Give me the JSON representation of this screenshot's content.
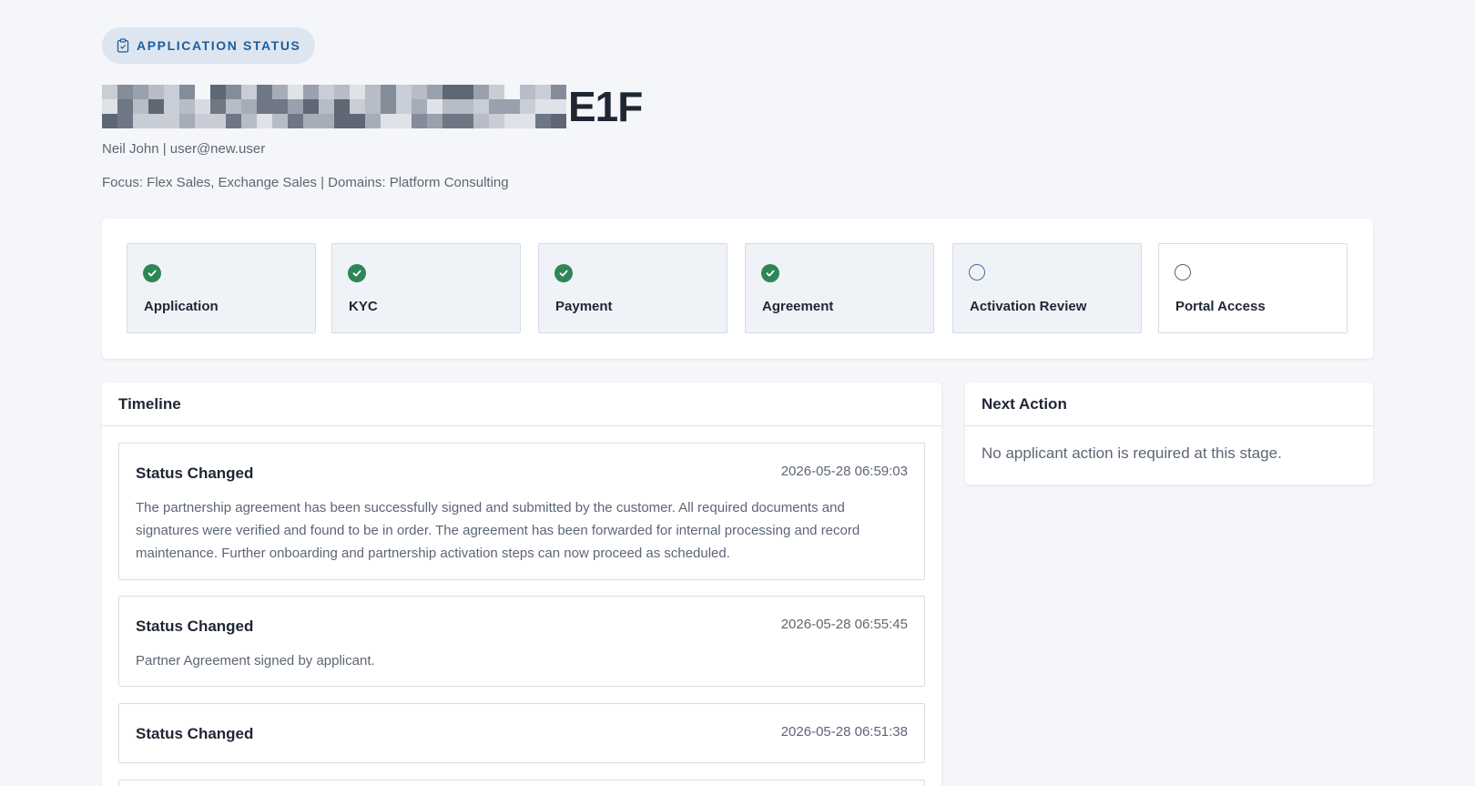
{
  "header": {
    "pill_label": "APPLICATION STATUS",
    "pill_icon": "clipboard-icon",
    "title_visible_suffix": "E1F",
    "user_line": "Neil John | user@new.user",
    "focus_line": "Focus: Flex Sales, Exchange Sales | Domains: Platform Consulting"
  },
  "stages": [
    {
      "label": "Application",
      "status": "complete",
      "icon": "check-circle-icon"
    },
    {
      "label": "KYC",
      "status": "complete",
      "icon": "check-circle-icon"
    },
    {
      "label": "Payment",
      "status": "complete",
      "icon": "check-circle-icon"
    },
    {
      "label": "Agreement",
      "status": "complete",
      "icon": "check-circle-icon"
    },
    {
      "label": "Activation Review",
      "status": "current",
      "icon": "empty-circle-icon"
    },
    {
      "label": "Portal Access",
      "status": "pending",
      "icon": "empty-circle-icon"
    }
  ],
  "timeline": {
    "title": "Timeline",
    "events": [
      {
        "title": "Status Changed",
        "time": "2026-05-28 06:59:03",
        "description": "The partnership agreement has been successfully signed and submitted by the customer. All required documents and signatures were verified and found to be in order. The agreement has been forwarded for internal processing and record maintenance. Further onboarding and partnership activation steps can now proceed as scheduled."
      },
      {
        "title": "Status Changed",
        "time": "2026-05-28 06:55:45",
        "description": "Partner Agreement signed by applicant."
      },
      {
        "title": "Status Changed",
        "time": "2026-05-28 06:51:38",
        "description": ""
      }
    ]
  },
  "next_action": {
    "title": "Next Action",
    "message": "No applicant action is required at this stage."
  },
  "colors": {
    "background": "#f4f6f9",
    "accent_blue": "#1f5d99",
    "complete_green": "#2e8656",
    "text_primary": "#1f2633",
    "text_muted": "#5d6675"
  }
}
